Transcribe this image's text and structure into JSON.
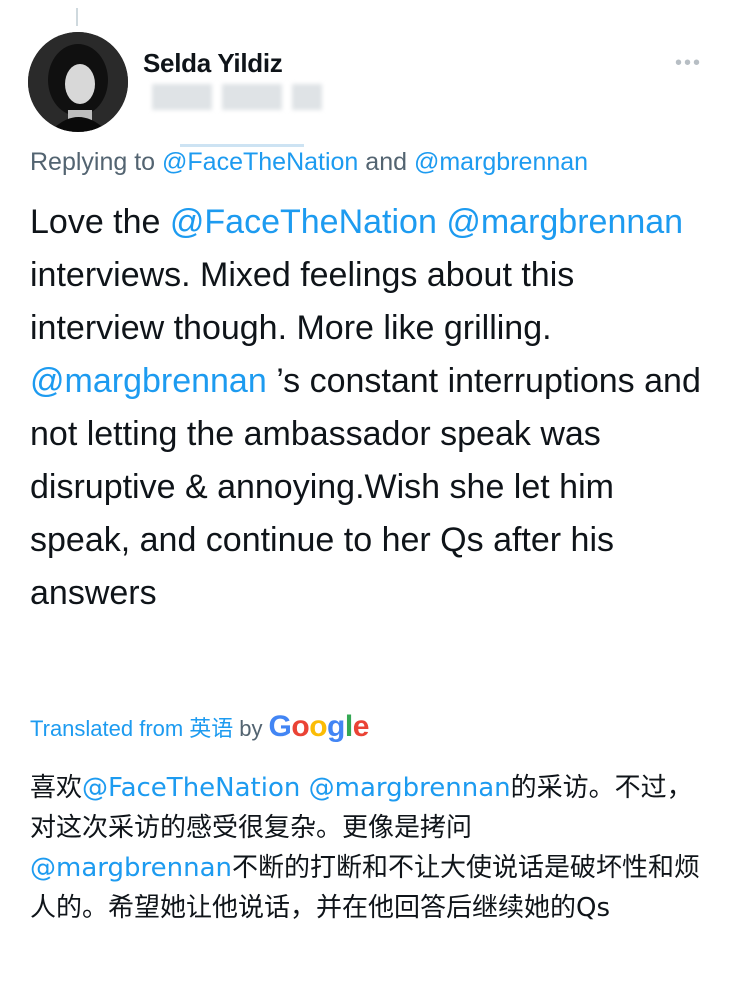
{
  "author": {
    "name": "Selda Yildiz"
  },
  "reply": {
    "prefix": "Replying to",
    "mention1": "@FaceTheNation",
    "conjunction": "and",
    "mention2": "@margbrennan"
  },
  "tweet": {
    "t1": "Love the ",
    "m1": "@FaceTheNation",
    "t2": " ",
    "m2": "@margbrennan",
    "t3": " interviews. Mixed feelings about this interview though. More like grilling. ",
    "m3": "@margbrennan",
    "t4": " ’s constant interruptions and not letting the ambassador speak was disruptive & annoying.Wish she let him speak, and continue to her Qs after his answers"
  },
  "translation_label": {
    "prefix": "Translated from",
    "language": "英语",
    "by": "by",
    "provider": "Google"
  },
  "translation": {
    "t1": "喜欢",
    "m1": "@FaceTheNation",
    "t2": " ",
    "m2": "@margbrennan",
    "t3": "的采访。不过，对这次采访的感受很复杂。更像是拷问",
    "m3": "@margbrennan",
    "t4": "不断的打断和不让大使说话是破坏性和烦人的。希望她让他说话，并在他回答后继续她的Qs"
  },
  "colors": {
    "link": "#1d9bf0",
    "secondary_text": "#536471",
    "text": "#0f1419"
  },
  "icons": {
    "more": "more-icon"
  }
}
